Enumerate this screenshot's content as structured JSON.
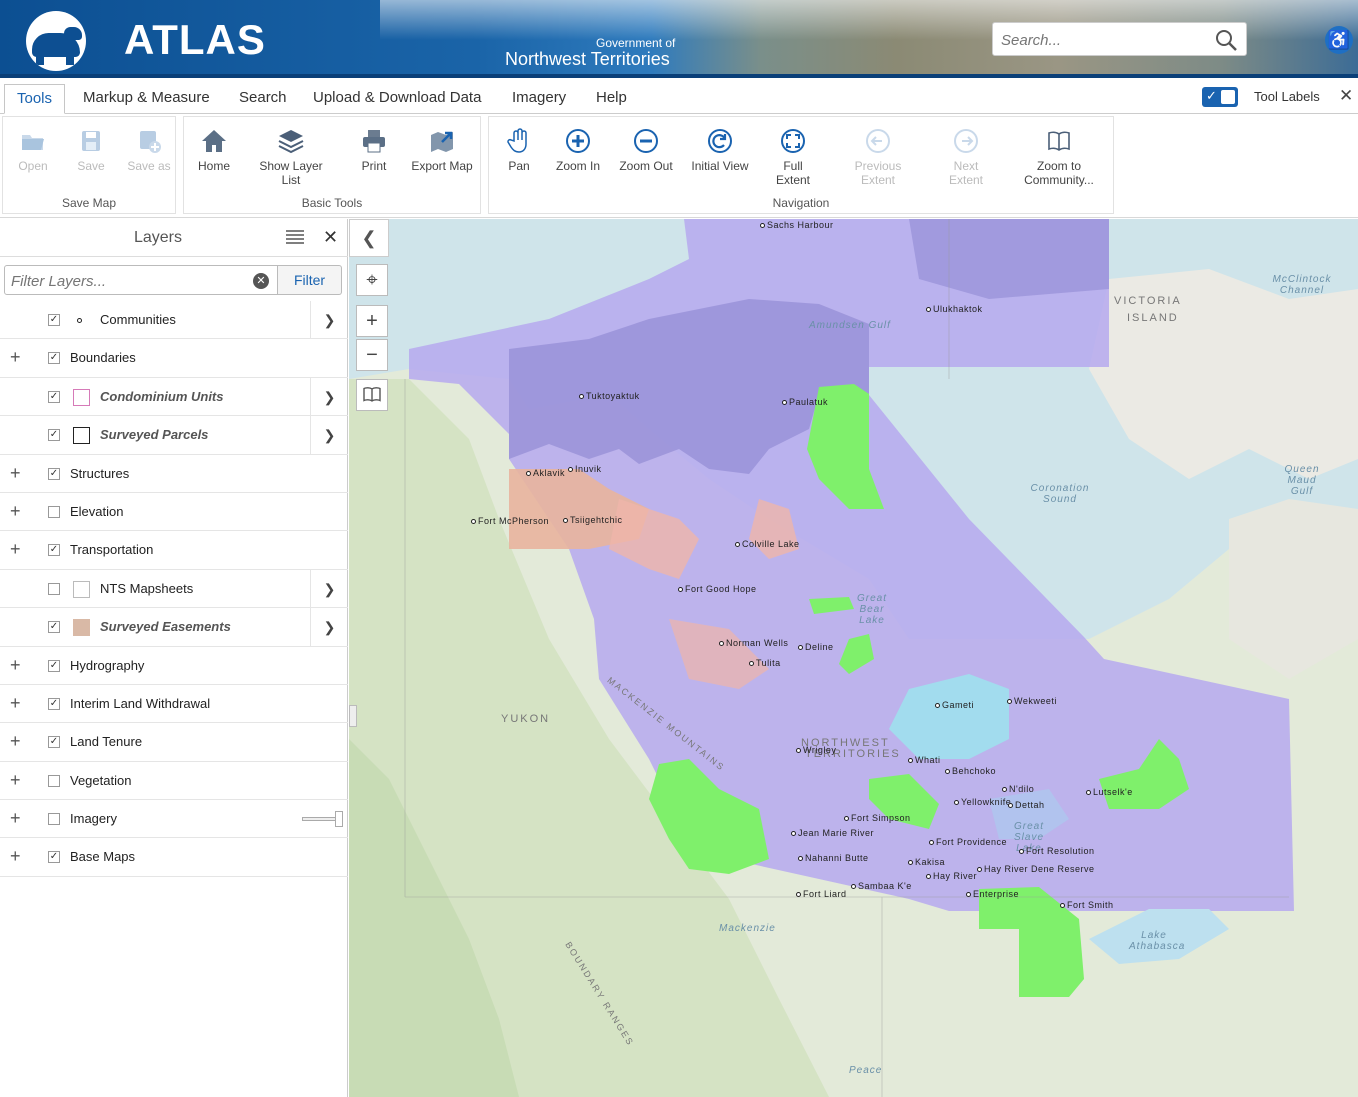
{
  "header": {
    "app_title": "ATLAS",
    "gov_subtitle": "Government of",
    "gov_name": "Northwest Territories",
    "search_placeholder": "Search..."
  },
  "tabs": [
    "Tools",
    "Markup & Measure",
    "Search",
    "Upload & Download Data",
    "Imagery",
    "Help"
  ],
  "active_tab": "Tools",
  "tool_labels_toggle": {
    "label": "Tool Labels",
    "checked": true
  },
  "ribbon": {
    "save_map": {
      "label": "Save Map",
      "tools": [
        "Open",
        "Save",
        "Save as"
      ]
    },
    "basic_tools": {
      "label": "Basic Tools",
      "tools": [
        "Home",
        "Show Layer List",
        "Print",
        "Export Map"
      ]
    },
    "navigation": {
      "label": "Navigation",
      "tools": [
        "Pan",
        "Zoom In",
        "Zoom Out",
        "Initial View",
        "Full Extent",
        "Previous Extent",
        "Next Extent",
        "Zoom to Community..."
      ]
    }
  },
  "layers_panel": {
    "title": "Layers",
    "filter_placeholder": "Filter Layers...",
    "filter_button": "Filter",
    "layers": [
      {
        "name": "Communities",
        "checked": true,
        "expandable": false,
        "sub": false,
        "symbol": "dot"
      },
      {
        "name": "Boundaries",
        "checked": true,
        "expandable": true,
        "sub": false
      },
      {
        "name": "Condominium Units",
        "checked": true,
        "expandable": false,
        "sub": true,
        "symbol": "swatch",
        "color": "#d67ab8"
      },
      {
        "name": "Surveyed Parcels",
        "checked": true,
        "expandable": false,
        "sub": true,
        "symbol": "swatch",
        "color": "#222222"
      },
      {
        "name": "Structures",
        "checked": true,
        "expandable": true,
        "sub": false
      },
      {
        "name": "Elevation",
        "checked": false,
        "expandable": true,
        "sub": false
      },
      {
        "name": "Transportation",
        "checked": true,
        "expandable": true,
        "sub": false
      },
      {
        "name": "NTS Mapsheets",
        "checked": false,
        "expandable": false,
        "sub": false,
        "symbol": "swatch",
        "color": "#bbbbbb"
      },
      {
        "name": "Surveyed Easements",
        "checked": true,
        "expandable": false,
        "sub": true,
        "symbol": "swatch",
        "color": "#d9b9a6"
      },
      {
        "name": "Hydrography",
        "checked": true,
        "expandable": true,
        "sub": false
      },
      {
        "name": "Interim Land Withdrawal",
        "checked": true,
        "expandable": true,
        "sub": false
      },
      {
        "name": "Land Tenure",
        "checked": true,
        "expandable": true,
        "sub": false
      },
      {
        "name": "Vegetation",
        "checked": false,
        "expandable": true,
        "sub": false
      },
      {
        "name": "Imagery",
        "checked": false,
        "expandable": true,
        "sub": false,
        "slider": true
      },
      {
        "name": "Base Maps",
        "checked": true,
        "expandable": true,
        "sub": false
      }
    ]
  },
  "map": {
    "places": [
      "Sachs Harbour",
      "Ulukhaktok",
      "Paulatuk",
      "Tuktoyaktuk",
      "Aklavik",
      "Inuvik",
      "Fort McPherson",
      "Tsiigehtchic",
      "Colville Lake",
      "Fort Good Hope",
      "Norman Wells",
      "Deline",
      "Tulita",
      "Gameti",
      "Wekweeti",
      "Wrigley",
      "Whati",
      "Behchoko",
      "N'dilo",
      "Yellowknife",
      "Dettah",
      "Lutselk'e",
      "Fort Simpson",
      "Jean Marie River",
      "Fort Providence",
      "Fort Resolution",
      "Nahanni Butte",
      "Kakisa",
      "Hay River",
      "Hay River Dene Reserve",
      "Enterprise",
      "Fort Liard",
      "Sambaa K'e",
      "Fort Smith"
    ],
    "regions": [
      "VICTORIA",
      "ISLAND",
      "YUKON",
      "NORTHWEST",
      "TERRITORIES",
      "MACKENZIE MOUNTAINS",
      "BOUNDARY RANGES"
    ],
    "water": [
      "Amundsen Gulf",
      "McClintock Channel",
      "Queen Maud Gulf",
      "Coronation Sound",
      "Great Bear Lake",
      "Great Slave Lake",
      "Lake Athabasca",
      "Mackenzie",
      "Peace"
    ]
  }
}
